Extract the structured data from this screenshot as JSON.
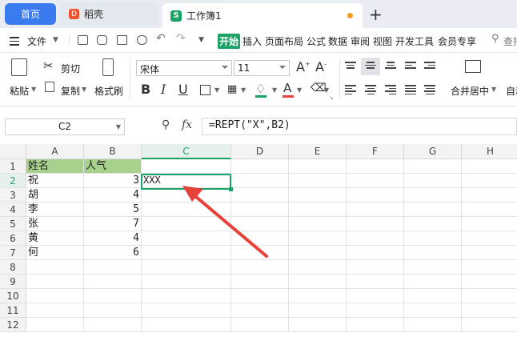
{
  "tabs": {
    "home": "首页",
    "daoke": "稻壳",
    "book": "工作簿1",
    "daoke_icon": "D",
    "book_icon": "S",
    "plus": "+"
  },
  "menu": {
    "file": "文件",
    "items": [
      "开始",
      "插入",
      "页面布局",
      "公式",
      "数据",
      "审阅",
      "视图",
      "开发工具",
      "会员专享"
    ],
    "search": "查找"
  },
  "ribbon": {
    "paste": "粘贴",
    "cut": "剪切",
    "copy": "复制",
    "format_painter": "格式刷",
    "font_name": "宋体",
    "font_size": "11",
    "merge_center": "合并居中",
    "auto_wrap": "自动"
  },
  "formula_bar": {
    "cell_ref": "C2",
    "fx": "fx",
    "formula": "=REPT(\"X\",B2)"
  },
  "sheet": {
    "columns": [
      "A",
      "B",
      "C",
      "D",
      "E",
      "F",
      "G",
      "H"
    ],
    "rows": [
      "1",
      "2",
      "3",
      "4",
      "5",
      "6",
      "7",
      "8",
      "9",
      "10",
      "11",
      "12"
    ],
    "header": [
      "姓名",
      "人气"
    ],
    "names": [
      "祝",
      "胡",
      "李",
      "张",
      "黄",
      "何"
    ],
    "values": [
      "3",
      "4",
      "5",
      "7",
      "4",
      "6"
    ],
    "c2_value": "XXX",
    "active_cell": "C2",
    "header_fill_color": "#a9d18e",
    "selection_color": "#1aa364",
    "arrow_color": "#e8413a"
  }
}
